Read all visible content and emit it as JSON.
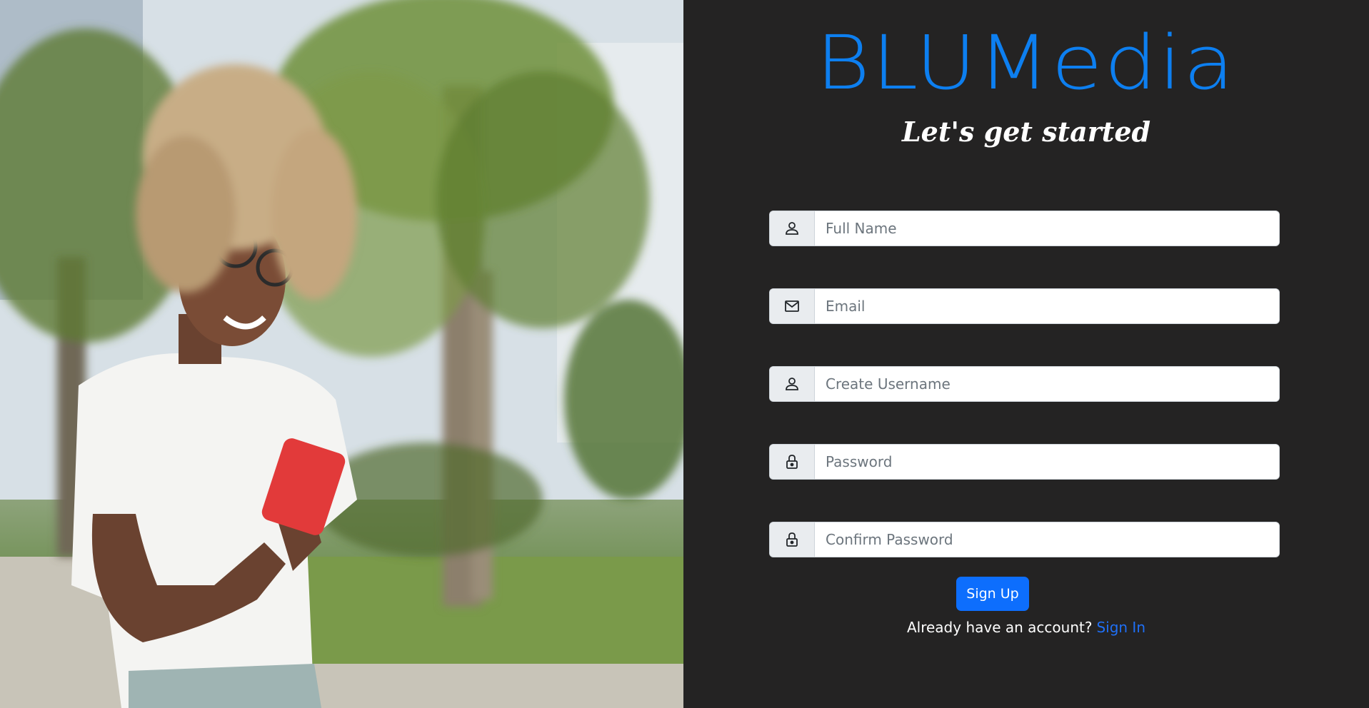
{
  "brand": {
    "name": "BLUMedia",
    "color": "#0d7ff0"
  },
  "hero": {
    "tagline": "Let's get started"
  },
  "form": {
    "fields": [
      {
        "icon": "person-icon",
        "placeholder": "Full Name",
        "value": ""
      },
      {
        "icon": "envelope-icon",
        "placeholder": "Email",
        "value": ""
      },
      {
        "icon": "person-icon",
        "placeholder": "Create Username",
        "value": ""
      },
      {
        "icon": "lock-icon",
        "placeholder": "Password",
        "value": ""
      },
      {
        "icon": "lock-icon",
        "placeholder": "Confirm Password",
        "value": ""
      }
    ],
    "submit_label": "Sign Up",
    "signin_prompt": "Already have an account?",
    "signin_link": "Sign In"
  },
  "colors": {
    "panel_bg": "#242323",
    "primary_button": "#0d6efd",
    "link": "#1f6ff5"
  }
}
